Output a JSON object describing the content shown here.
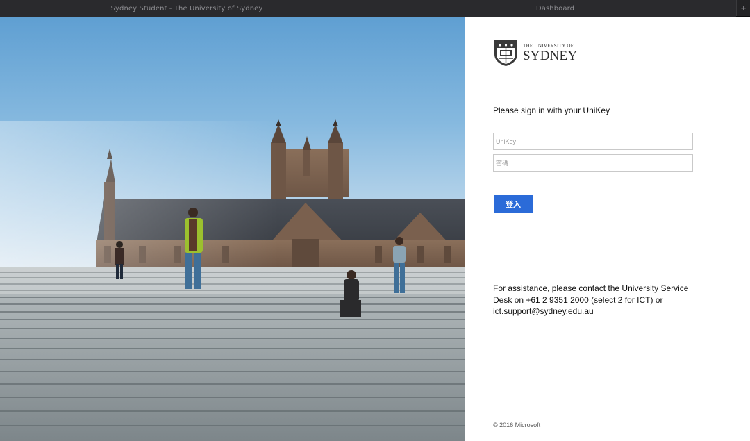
{
  "browser": {
    "tabs": [
      {
        "title": "Sydney Student - The University of Sydney"
      },
      {
        "title": "Dashboard"
      }
    ],
    "new_tab_glyph": "+"
  },
  "hero": {
    "icon": "campus-photo"
  },
  "brand": {
    "logo_icon": "university-crest-icon",
    "line1": "THE UNIVERSITY OF",
    "line2": "SYDNEY"
  },
  "signin": {
    "title": "Please sign in with your UniKey",
    "username_placeholder": "UniKey",
    "password_placeholder": "密碼",
    "login_label": "登入",
    "accent_color": "#2b6bd8"
  },
  "assistance": {
    "text": "For assistance, please contact the University Service Desk on +61 2 9351 2000 (select 2 for ICT) or ict.support@sydney.edu.au"
  },
  "footer": {
    "copyright": "© 2016 Microsoft"
  }
}
